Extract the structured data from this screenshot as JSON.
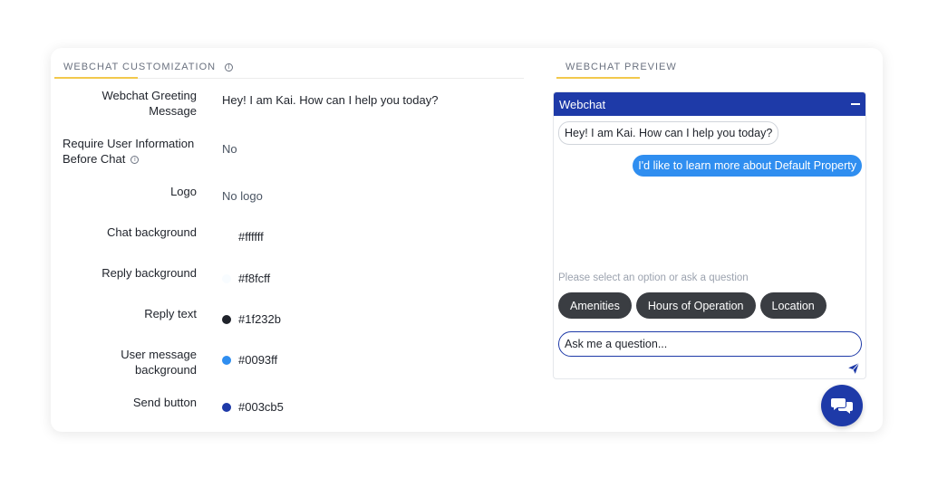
{
  "left_section": {
    "title": "WEBCHAT CUSTOMIZATION",
    "info_symbol": "i"
  },
  "right_section": {
    "title": "WEBCHAT PREVIEW"
  },
  "settings": [
    {
      "label": "Webchat Greeting Message",
      "value": "Hey! I am Kai. How can I help you today?"
    },
    {
      "label": "Require User Information Before Chat",
      "value": "No"
    },
    {
      "label": "Logo",
      "value": "No logo"
    },
    {
      "label": "Chat background",
      "value": "#ffffff",
      "color": "#ffffff"
    },
    {
      "label": "Reply background",
      "value": "#f8fcff",
      "color": "#f8fcff"
    },
    {
      "label": "Reply text",
      "value": "#1f232b",
      "color": "#1f232b"
    },
    {
      "label": "User message background",
      "value": "#0093ff",
      "color": "#2f8ef0"
    },
    {
      "label": "Send button",
      "value": "#003cb5",
      "color": "#1e3aa8"
    }
  ],
  "preview": {
    "header_title": "Webchat",
    "bot_message": "Hey! I am Kai. How can I help you today?",
    "user_message": "I'd like to learn more about Default Property",
    "prompt": "Please select an option or ask a question",
    "options": [
      "Amenities",
      "Hours of Operation",
      "Location"
    ],
    "input_placeholder": "Ask me a question..."
  },
  "icons": {
    "info": "info-icon",
    "minimize": "minimize-icon",
    "send": "send-icon",
    "chat": "chat-bubbles-icon"
  },
  "colors": {
    "accent_yellow": "#f2c94c",
    "header_blue": "#1e3aa8",
    "user_bubble": "#2f8ef0",
    "chip_dark": "#3a3d42"
  }
}
